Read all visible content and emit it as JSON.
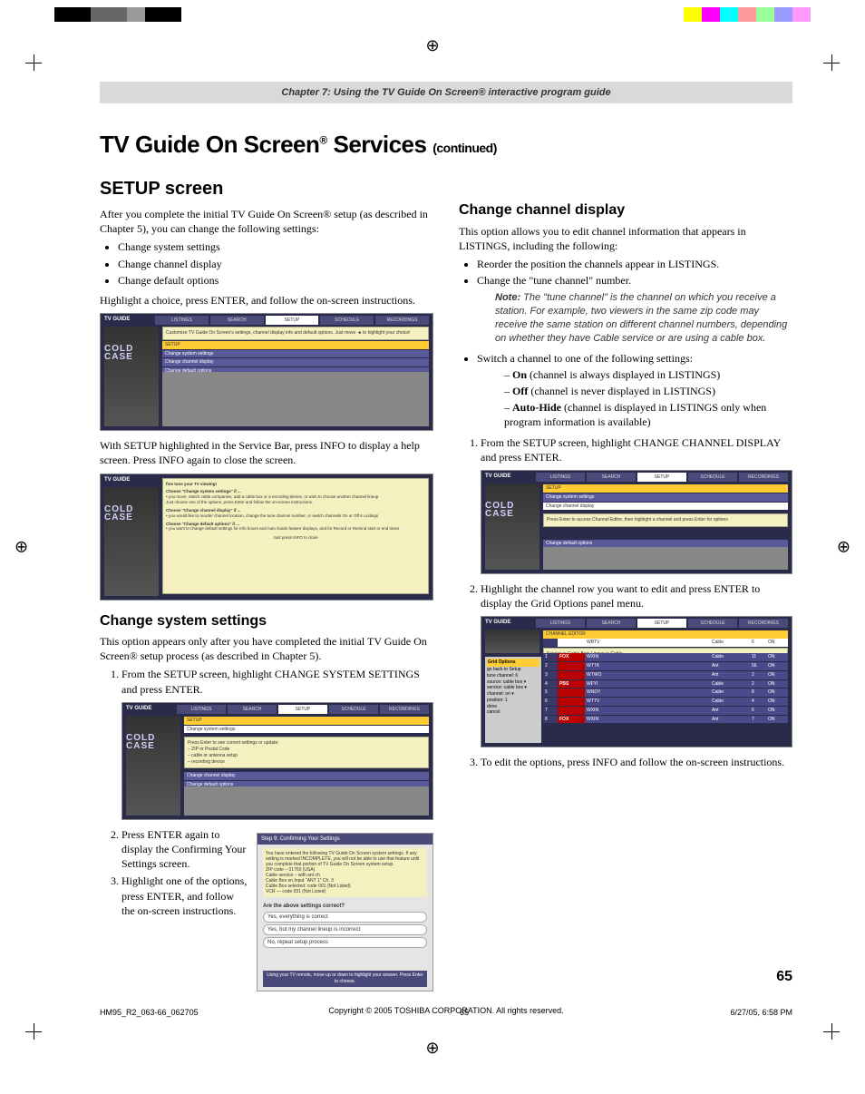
{
  "chapter_banner": "Chapter 7: Using the TV Guide On Screen® interactive program guide",
  "title_main": "TV Guide On Screen",
  "title_services": " Services ",
  "title_continued": "(continued)",
  "setup_heading": "SETUP screen",
  "setup_intro": "After you complete the initial TV Guide On Screen® setup (as described in Chapter 5), you can change the following settings:",
  "setup_bullets": [
    "Change system settings",
    "Change channel display",
    "Change default options"
  ],
  "setup_after_bullets": "Highlight a choice, press ENTER, and follow the on-screen instructions.",
  "setup_after_ss1": "With SETUP highlighted in the Service Bar, press INFO to display a help screen. Press INFO again to close the screen.",
  "css_heading": "Change system settings",
  "css_intro": "This option appears only after you have completed the initial TV Guide On Screen® setup process (as described in Chapter 5).",
  "css_step1": "From the SETUP screen, highlight CHANGE SYSTEM SETTINGS and press ENTER.",
  "css_step2": "Press ENTER again to display the Confirming Your Settings screen.",
  "css_step3": "Highlight one of the options, press ENTER, and follow the on-screen instructions.",
  "ccd_heading": "Change channel display",
  "ccd_intro": "This option allows you to edit channel information that appears in LISTINGS, including the following:",
  "ccd_b1": "Reorder the position the channels appear in LISTINGS.",
  "ccd_b2": "Change the \"tune channel\" number.",
  "ccd_note": "The \"tune channel\" is the channel on which you receive a station. For example, two viewers in the same zip code may receive the same station on different channel numbers, depending on whether they have Cable service or are using a cable box.",
  "ccd_b3": "Switch a channel to one of the following settings:",
  "ccd_dash_on": "On (channel is always displayed in LISTINGS)",
  "ccd_dash_off": "Off (channel is never displayed in LISTINGS)",
  "ccd_dash_auto": "Auto-Hide (channel is displayed in LISTINGS only when program information is available)",
  "ccd_step1": "From the SETUP screen, highlight CHANGE CHANNEL DISPLAY and press ENTER.",
  "ccd_step2": "Highlight the channel row you want to edit and press ENTER to display the Grid Options panel menu.",
  "ccd_step3": "To edit the options, press INFO and follow the on-screen instructions.",
  "copyright": "Copyright © 2005 TOSHIBA CORPORATION. All rights reserved.",
  "page_number": "65",
  "footer_left": "HM95_R2_063-66_062705",
  "footer_center": "65",
  "footer_right": "6/27/05, 6:58 PM",
  "ss_tabs": [
    "LISTINGS",
    "SEARCH",
    "SETUP",
    "SCHEDULE",
    "RECORDINGS"
  ],
  "ss_logo": "TV GUIDE",
  "ss_cold": "COLD CASE",
  "ss1": {
    "tip": "Customize TV Guide On Screen's settings, channel display info and default options. Just move ◄ to highlight your choice!",
    "rows": [
      "SETUP",
      "Change system settings",
      "Change channel display",
      "Change default options"
    ]
  },
  "ss2": {
    "tip_title": "fine tune your TV viewing!",
    "g1_title": "Choose \"Change system settings\" if ...",
    "g1_body": "• you move, switch cable companies, add a cable box or a recording device, or wish to choose another channel lineup",
    "g1_body2": "Just choose one of the options, press Enter and follow the on-screen instructions.",
    "g2_title": "Choose \"Change channel display\" if ...",
    "g2_body": "• you would like to reorder channel location, change the tune channel number, or switch channels On or Off in Listings",
    "g3_title": "Choose \"Change default options\" if ...",
    "g3_body": "• you want to change default settings for Info boxes and Auto Guide feature displays, and for Record or Remind start or end times",
    "g_footer": "Just press INFO to close"
  },
  "ss3": {
    "rows": [
      "SETUP",
      "Change system settings"
    ],
    "yellow_title": "Press Enter to see current settings or update:",
    "yellow_lines": [
      "– ZIP or Postal Code",
      "– cable or antenna setup",
      "– recording device"
    ],
    "rows_bottom": [
      "Change channel display",
      "Change default options"
    ]
  },
  "ss4": {
    "header": "Step 9: Confirming Your Settings",
    "intro": "You have entered the following TV Guide On Screen system settings. If any setting is marked INCOMPLETE, you will not be able to use that feature until you complete that portion of TV Guide On Screen system setup.",
    "lines": [
      "ZIP code – 01760 (USA)",
      "Cable service – with ant ch",
      "Cable Box on Input \"ANT 1\" Ch. 3",
      "Cable Box selected: code 001 (Not Listed)",
      "VCR — code 031 (Not Listed)"
    ],
    "question": "Are the above settings correct?",
    "opts": [
      "Yes, everything is correct",
      "Yes, but my channel lineup is incorrect",
      "No, repeat setup process"
    ],
    "foot": "Using your TV remote, move up or down to highlight your answer. Press Enter to choose."
  },
  "ss5": {
    "rows_top": [
      "SETUP",
      "Change system settings",
      "Change channel display"
    ],
    "yellow": "Press Enter to access Channel Editor, then highlight a channel and press Enter for options",
    "rows_bottom": [
      "Change default options"
    ]
  },
  "ss6": {
    "editor_title": "CHANNEL EDITOR",
    "header_row": {
      "call": "WBTV",
      "src": "Cable",
      "num": "6",
      "state": "ON"
    },
    "sub": "Service is Cable Box; Lineup is Cable",
    "panel_title": "Grid Options",
    "panel_items": [
      "go back to Setup",
      "tune channel: 6",
      "source: cable box ▾",
      "service: cable box ▾",
      "channel: on ▾",
      "position: 1",
      "done",
      "cancel"
    ],
    "rows": [
      {
        "n": "1",
        "logo": "FOX",
        "call": "WXIN",
        "src": "Cable",
        "num": "11",
        "state": "ON"
      },
      {
        "n": "2",
        "logo": "",
        "call": "WTTK",
        "src": "Ant",
        "num": "56",
        "state": "ON"
      },
      {
        "n": "3",
        "logo": "",
        "call": "WTWO",
        "src": "Ant",
        "num": "2",
        "state": "ON"
      },
      {
        "n": "4",
        "logo": "PBS",
        "call": "WFYI",
        "src": "Cable",
        "num": "2",
        "state": "ON"
      },
      {
        "n": "5",
        "logo": "",
        "call": "WNDY",
        "src": "Cable",
        "num": "8",
        "state": "ON"
      },
      {
        "n": "6",
        "logo": "",
        "call": "WTTV",
        "src": "Cable",
        "num": "4",
        "state": "ON"
      },
      {
        "n": "7",
        "logo": "",
        "call": "WXIN",
        "src": "Ant",
        "num": "6",
        "state": "ON"
      },
      {
        "n": "8",
        "logo": "FOX",
        "call": "WXIN",
        "src": "Ant",
        "num": "7",
        "state": "ON"
      }
    ]
  },
  "note_label": "Note:"
}
